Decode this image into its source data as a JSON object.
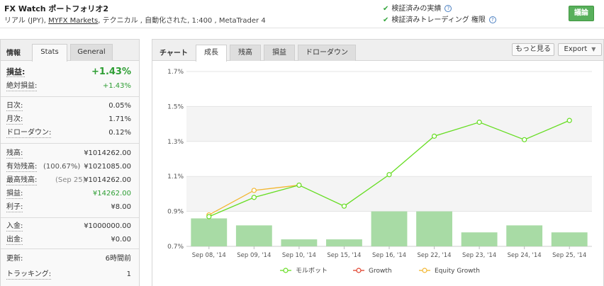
{
  "header": {
    "title": "FX Watch ポートフォリオ2",
    "subtitle_prefix": "リアル (JPY), ",
    "broker": "MYFX Markets",
    "subtitle_suffix": ", テクニカル , 自動化された, 1:400 , MetaTrader 4",
    "verified_track": "検証済みの実績",
    "verified_privileges": "検証済みトレーディング 権限",
    "discuss_label": "議論"
  },
  "left": {
    "section_label": "情報",
    "tabs": [
      "Stats",
      "General"
    ],
    "gain": {
      "label": "損益:",
      "value": "+1.43%"
    },
    "abs_gain": {
      "label": "絶対損益:",
      "value": "+1.43%"
    },
    "daily": {
      "label": "日次:",
      "value": "0.05%"
    },
    "monthly": {
      "label": "月次:",
      "value": "1.71%"
    },
    "drawdown": {
      "label": "ドローダウン:",
      "value": "0.12%"
    },
    "balance": {
      "label": "残高:",
      "value": "¥1014262.00"
    },
    "equity": {
      "label": "有効残高:",
      "pre": "(100.67%)",
      "value": "¥1021085.00"
    },
    "highest": {
      "label": "最高残高:",
      "pre": "(Sep 25)",
      "value": "¥1014262.00"
    },
    "profit": {
      "label": "損益:",
      "value": "¥14262.00"
    },
    "interest": {
      "label": "利子:",
      "value": "¥8.00"
    },
    "deposits": {
      "label": "入金:",
      "value": "¥1000000.00"
    },
    "withdrawals": {
      "label": "出金:",
      "value": "¥0.00"
    },
    "updated": {
      "label": "更新:",
      "value": "6時間前"
    },
    "tracking": {
      "label": "トラッキング:",
      "value": "1"
    }
  },
  "right": {
    "section_label": "チャート",
    "tabs": [
      "成長",
      "残高",
      "損益",
      "ドローダウン"
    ],
    "more_label": "もっと見る",
    "export_label": "Export"
  },
  "colors": {
    "growth_line": "#66dd22",
    "equity_line": "#f2b630",
    "bar": "#a8dba5",
    "green_text": "#2e9e34",
    "discuss_button": "#58b05c"
  },
  "chart_data": {
    "type": "line",
    "categories": [
      "Sep 08, '14",
      "Sep 09, '14",
      "Sep 10, '14",
      "Sep 15, '14",
      "Sep 16, '14",
      "Sep 22, '14",
      "Sep 23, '14",
      "Sep 24, '14",
      "Sep 25, '14"
    ],
    "y_ticks": [
      "1.7%",
      "1.5%",
      "1.3%",
      "1.1%",
      "0.9%",
      "0.7%"
    ],
    "ylim": [
      0.7,
      1.7
    ],
    "series": [
      {
        "name": "モルボット",
        "type": "line",
        "values": [
          0.87,
          0.98,
          1.05,
          0.93,
          1.11,
          1.33,
          1.41,
          1.31,
          1.42
        ]
      },
      {
        "name": "Growth",
        "type": "line",
        "values": []
      },
      {
        "name": "Equity Growth",
        "type": "line",
        "values": [
          0.88,
          1.02,
          1.05
        ]
      }
    ],
    "bars": [
      0.86,
      0.82,
      0.74,
      0.74,
      0.9,
      0.9,
      0.78,
      0.82,
      0.78
    ],
    "legend_position": "bottom",
    "grid": true
  }
}
